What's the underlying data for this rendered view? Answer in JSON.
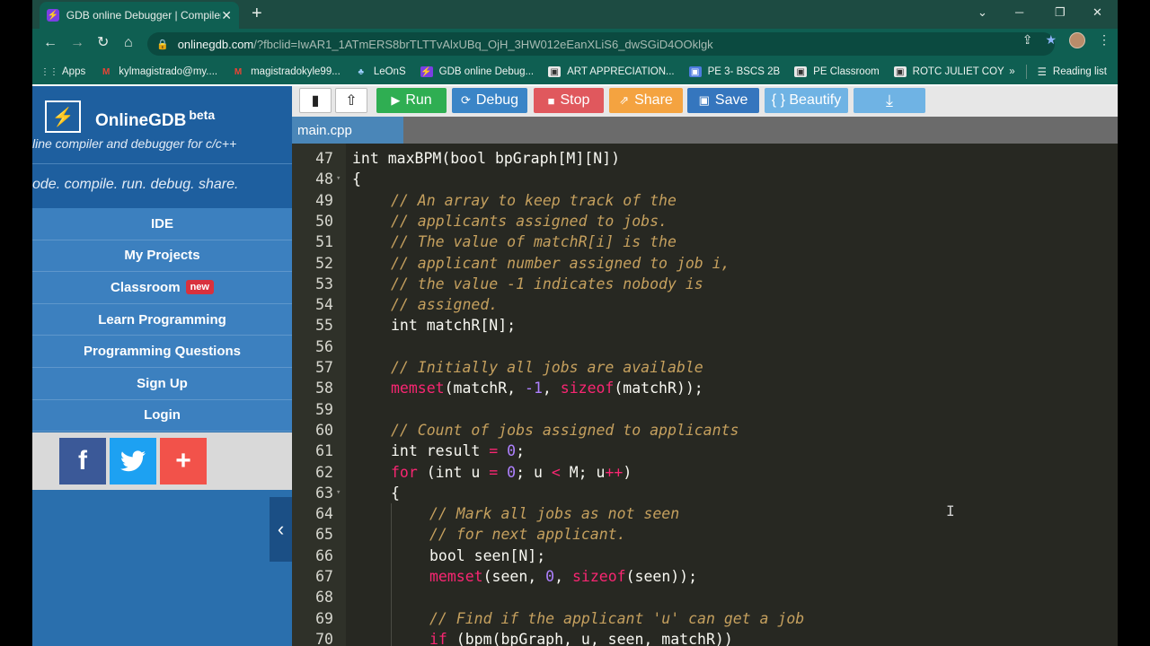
{
  "browser": {
    "tab_title": "GDB online Debugger | Compiler",
    "url_main": "onlinegdb.com",
    "url_rest": "/?fbclid=IwAR1_1ATmERS8brTLTTvAlxUBq_OjH_3HW012eEanXLiS6_dwSGiD4OOklgk",
    "bookmarks": [
      "Apps",
      "kylmagistrado@my....",
      "magistradokyle99...",
      "LeOnS",
      "GDB online Debug...",
      "ART APPRECIATION...",
      "PE 3- BSCS 2B",
      "PE Classroom",
      "ROTC JULIET COY"
    ],
    "reading_list": "Reading list"
  },
  "sidebar": {
    "brand": "OnlineGDB",
    "brand_sup": "beta",
    "tagline": "line compiler and debugger for c/c++",
    "motto": "ode. compile. run. debug. share.",
    "menu": [
      "IDE",
      "My Projects",
      "Classroom",
      "Learn Programming",
      "Programming Questions",
      "Sign Up",
      "Login"
    ],
    "new_badge": "new"
  },
  "toolbar": {
    "run": "Run",
    "debug": "Debug",
    "stop": "Stop",
    "share": "Share",
    "save": "Save",
    "beautify": "{ } Beautify"
  },
  "file_tab": "main.cpp",
  "colors": {
    "run": "#2fae52",
    "debug": "#3a85c7",
    "stop": "#e0585d",
    "share": "#f4a340",
    "save": "#3576be",
    "beautify": "#6fb3e4",
    "download": "#6fb3e4",
    "comment": "#c5a05e",
    "keyword": "#f92672",
    "number": "#ae81ff"
  },
  "code_lines": [
    {
      "n": "47",
      "fold": "",
      "indent": 0,
      "segments": [
        {
          "t": "int maxBPM(bool bpGraph[M][N])",
          "c": "plain"
        }
      ]
    },
    {
      "n": "48",
      "fold": "▾",
      "indent": 0,
      "segments": [
        {
          "t": "{",
          "c": "plain"
        }
      ]
    },
    {
      "n": "49",
      "fold": "",
      "indent": 1,
      "segments": [
        {
          "t": "// An array to keep track of the",
          "c": "comment"
        }
      ]
    },
    {
      "n": "50",
      "fold": "",
      "indent": 1,
      "segments": [
        {
          "t": "// applicants assigned to jobs.",
          "c": "comment"
        }
      ]
    },
    {
      "n": "51",
      "fold": "",
      "indent": 1,
      "segments": [
        {
          "t": "// The value of matchR[i] is the",
          "c": "comment"
        }
      ]
    },
    {
      "n": "52",
      "fold": "",
      "indent": 1,
      "segments": [
        {
          "t": "// applicant number assigned to job i,",
          "c": "comment"
        }
      ]
    },
    {
      "n": "53",
      "fold": "",
      "indent": 1,
      "segments": [
        {
          "t": "// the value -1 indicates nobody is",
          "c": "comment"
        }
      ]
    },
    {
      "n": "54",
      "fold": "",
      "indent": 1,
      "segments": [
        {
          "t": "// assigned.",
          "c": "comment"
        }
      ]
    },
    {
      "n": "55",
      "fold": "",
      "indent": 1,
      "segments": [
        {
          "t": "int matchR[N];",
          "c": "plain"
        }
      ]
    },
    {
      "n": "56",
      "fold": "",
      "indent": 1,
      "segments": []
    },
    {
      "n": "57",
      "fold": "",
      "indent": 1,
      "segments": [
        {
          "t": "// Initially all jobs are available",
          "c": "comment"
        }
      ]
    },
    {
      "n": "58",
      "fold": "",
      "indent": 1,
      "segments": [
        {
          "t": "memset",
          "c": "keyword"
        },
        {
          "t": "(matchR, ",
          "c": "plain"
        },
        {
          "t": "-1",
          "c": "number"
        },
        {
          "t": ", ",
          "c": "plain"
        },
        {
          "t": "sizeof",
          "c": "keyword"
        },
        {
          "t": "(matchR));",
          "c": "plain"
        }
      ]
    },
    {
      "n": "59",
      "fold": "",
      "indent": 1,
      "segments": []
    },
    {
      "n": "60",
      "fold": "",
      "indent": 1,
      "segments": [
        {
          "t": "// Count of jobs assigned to applicants",
          "c": "comment"
        }
      ]
    },
    {
      "n": "61",
      "fold": "",
      "indent": 1,
      "segments": [
        {
          "t": "int result ",
          "c": "plain"
        },
        {
          "t": "=",
          "c": "keyword"
        },
        {
          "t": " ",
          "c": "plain"
        },
        {
          "t": "0",
          "c": "number"
        },
        {
          "t": ";",
          "c": "plain"
        }
      ]
    },
    {
      "n": "62",
      "fold": "",
      "indent": 1,
      "segments": [
        {
          "t": "for",
          "c": "keyword"
        },
        {
          "t": " (int u ",
          "c": "plain"
        },
        {
          "t": "=",
          "c": "keyword"
        },
        {
          "t": " ",
          "c": "plain"
        },
        {
          "t": "0",
          "c": "number"
        },
        {
          "t": "; u ",
          "c": "plain"
        },
        {
          "t": "<",
          "c": "keyword"
        },
        {
          "t": " M; u",
          "c": "plain"
        },
        {
          "t": "++",
          "c": "keyword"
        },
        {
          "t": ")",
          "c": "plain"
        }
      ]
    },
    {
      "n": "63",
      "fold": "▾",
      "indent": 1,
      "segments": [
        {
          "t": "{",
          "c": "plain"
        }
      ]
    },
    {
      "n": "64",
      "fold": "",
      "indent": 2,
      "segments": [
        {
          "t": "// Mark all jobs as not seen",
          "c": "comment"
        }
      ]
    },
    {
      "n": "65",
      "fold": "",
      "indent": 2,
      "segments": [
        {
          "t": "// for next applicant.",
          "c": "comment"
        }
      ]
    },
    {
      "n": "66",
      "fold": "",
      "indent": 2,
      "segments": [
        {
          "t": "bool seen[N];",
          "c": "plain"
        }
      ]
    },
    {
      "n": "67",
      "fold": "",
      "indent": 2,
      "segments": [
        {
          "t": "memset",
          "c": "keyword"
        },
        {
          "t": "(seen, ",
          "c": "plain"
        },
        {
          "t": "0",
          "c": "number"
        },
        {
          "t": ", ",
          "c": "plain"
        },
        {
          "t": "sizeof",
          "c": "keyword"
        },
        {
          "t": "(seen));",
          "c": "plain"
        }
      ]
    },
    {
      "n": "68",
      "fold": "",
      "indent": 2,
      "segments": []
    },
    {
      "n": "69",
      "fold": "",
      "indent": 2,
      "segments": [
        {
          "t": "// Find if the applicant 'u' can get a job",
          "c": "comment"
        }
      ]
    },
    {
      "n": "70",
      "fold": "",
      "indent": 2,
      "segments": [
        {
          "t": "if",
          "c": "keyword"
        },
        {
          "t": " (bpm(bpGraph, u, seen, matchR))",
          "c": "plain"
        }
      ]
    }
  ]
}
